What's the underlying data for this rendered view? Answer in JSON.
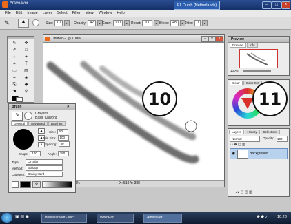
{
  "titlebar": {
    "app_name": "Artweaver",
    "locale": "EL Dutch (Netherlands)",
    "minimize": "–",
    "maximize": "□",
    "close": "×"
  },
  "menu": [
    "File",
    "Edit",
    "Image",
    "Layer",
    "Select",
    "Filter",
    "View",
    "Window",
    "Help"
  ],
  "options": {
    "size_label": "Size:",
    "size_value": "10",
    "opacity_label": "Opacity:",
    "opacity_value": "42",
    "grain_label": "Grain:",
    "grain_value": "100",
    "resat_label": "Resat:",
    "resat_value": "100",
    "bleed_label": "Bleed:",
    "bleed_value": "48",
    "jitter_label": "Jitter:",
    "jitter_value": "0"
  },
  "document": {
    "title": "Untitled-2 @ 100%",
    "status_zoom": "100%",
    "status_coords": "X: 519  Y: 388"
  },
  "brush": {
    "panel_title": "Brush",
    "category_name": "Crayons",
    "variant_name": "Basic Crayons",
    "tabs": [
      "General",
      "Advanced",
      "Brushes"
    ],
    "size_label": "Size:",
    "size_value": "50",
    "min_size_label": "Min Size:",
    "min_size_value": "100",
    "spacing_label": "Spacing:",
    "spacing_value": "50",
    "shape_label": "Shape:",
    "shape_value": "100",
    "angle_label": "Angle:",
    "angle_value": "180",
    "type_label": "Type:",
    "type_value": "Circular",
    "method_label": "Method:",
    "method_value": "Buildup",
    "category_label": "Category:",
    "category_value": "Grainy Hard"
  },
  "preview": {
    "title": "Preview",
    "tabs": [
      "Preview",
      "Info"
    ],
    "zoom": "100%"
  },
  "color": {
    "title": "Color",
    "tabs": [
      "Color",
      "Color Set"
    ]
  },
  "layers": {
    "tabs": [
      "Layers",
      "History",
      "Selections"
    ],
    "blend_mode": "Normal",
    "opacity_label": "Opacity:",
    "opacity_value": "100",
    "layer_name": "Background"
  },
  "callouts": [
    "10",
    "11"
  ],
  "taskbar": {
    "tasks": [
      "Heuwel reedt - Micr...",
      "WordPad",
      "Artweaver"
    ],
    "clock": "10:23"
  },
  "colors": {
    "accent": "#2a4d8f",
    "wheel_red": "#d9302a",
    "layer_selected": "#b8d2ee"
  }
}
